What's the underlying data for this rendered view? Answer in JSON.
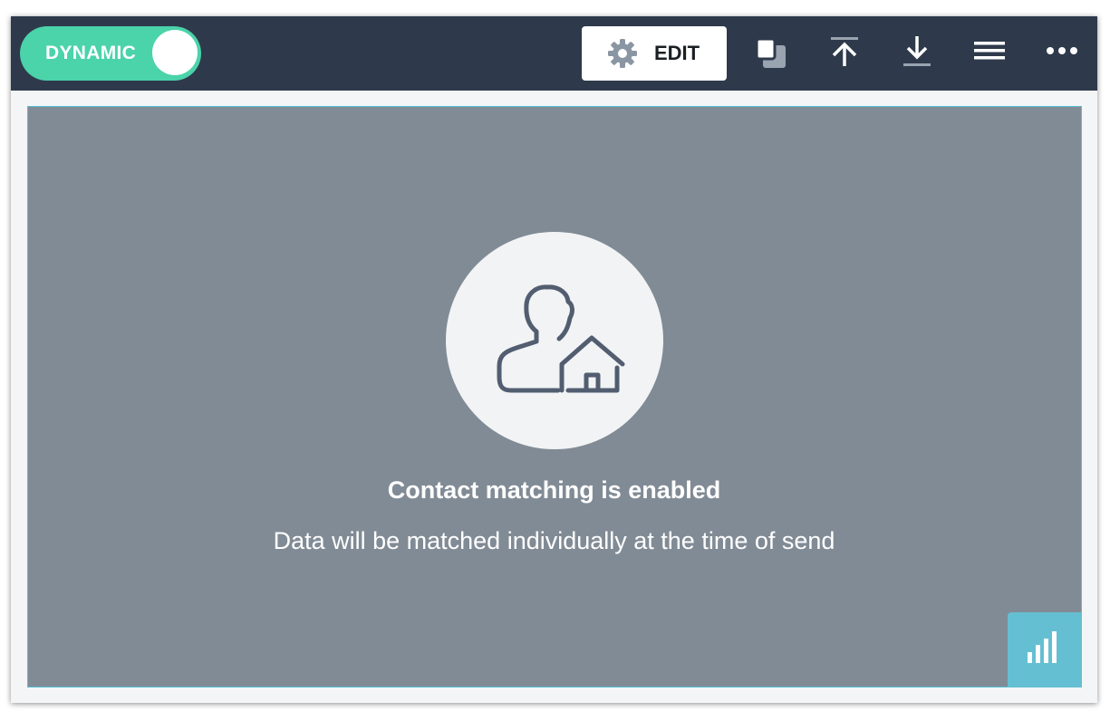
{
  "toolbar": {
    "toggle": {
      "label": "DYNAMIC",
      "state": "on",
      "color": "#4bd3aa"
    },
    "edit_button": {
      "label": "EDIT",
      "icon": "gear-icon"
    },
    "icons": [
      "duplicate-icon",
      "move-to-top-icon",
      "move-to-bottom-icon",
      "menu-icon",
      "more-options-icon"
    ],
    "background_color": "#2e3a4b"
  },
  "content": {
    "icon": "contact-home-icon",
    "title": "Contact matching is enabled",
    "description": "Data will be matched individually at the time of send",
    "background_color": "#818b95",
    "border_color": "#57c0d4"
  },
  "stats_button": {
    "icon": "bar-chart-icon",
    "color": "#64bfd2"
  }
}
